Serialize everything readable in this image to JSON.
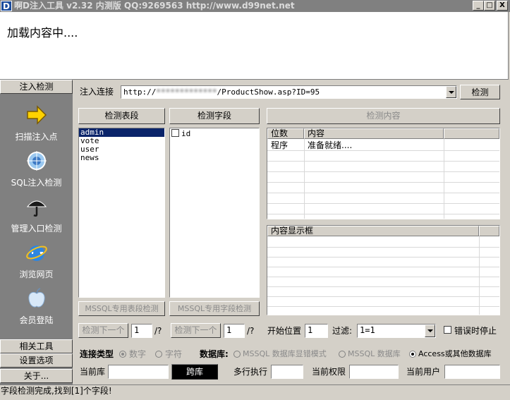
{
  "window": {
    "app_icon_letter": "D",
    "title": "啊D注入工具 v2.32 内测版 QQ:9269563 http://www.d99net.net",
    "btn_minimize": "_",
    "btn_maximize": "□",
    "btn_close": "X"
  },
  "browser": {
    "loading_text": "加载内容中...."
  },
  "sidebar": {
    "header": "注入检测",
    "items": [
      {
        "label": "扫描注入点",
        "icon": "arrow-right-icon"
      },
      {
        "label": "SQL注入检测",
        "icon": "globe-icon"
      },
      {
        "label": "管理入口检测",
        "icon": "umbrella-icon"
      },
      {
        "label": "浏览网页",
        "icon": "ie-icon"
      },
      {
        "label": "会员登陆",
        "icon": "apple-icon"
      }
    ],
    "footer": [
      "相关工具",
      "设置选项",
      "关于..."
    ]
  },
  "injection": {
    "label": "注入连接",
    "url_prefix": "http://",
    "url_masked": "*************",
    "url_suffix": "/ProductShow.asp?ID=95",
    "detect_button": "检测"
  },
  "tables": {
    "button": "检测表段",
    "items": [
      "admin",
      "vote",
      "user",
      "news"
    ],
    "selected_index": 0,
    "mssql_button": "MSSQL专用表段检测",
    "next_button": "检测下一个",
    "count_value": "1",
    "count_suffix": "/?"
  },
  "fields": {
    "button": "检测字段",
    "items": [
      "id"
    ],
    "mssql_button": "MSSQL专用字段检测",
    "next_button": "检测下一个",
    "count_value": "1",
    "count_suffix": "/?"
  },
  "content": {
    "button": "检测内容",
    "columns": [
      "位数",
      "内容"
    ],
    "rows": [
      {
        "pos": "程序",
        "content": "准备就绪...."
      }
    ],
    "display_header": "内容显示框"
  },
  "options": {
    "start_label": "开始位置",
    "start_value": "1",
    "filter_label": "过滤:",
    "filter_value": "1=1",
    "stop_on_error_label": "错误时停止",
    "stop_on_error": false
  },
  "connection": {
    "type_label": "连接类型",
    "type_numeric": "数字",
    "type_char": "字符",
    "db_label": "数据库:",
    "db_mssql_error": "MSSQL 数据库显错模式",
    "db_mssql": "MSSQL 数据库",
    "db_access": "Access或其他数据库",
    "selected_db": "access"
  },
  "info": {
    "current_db_label": "当前库",
    "current_db_value": "",
    "cross_db_button": "跨库",
    "multi_exec_label": "多行执行",
    "multi_exec_value": "",
    "current_priv_label": "当前权限",
    "current_priv_value": "",
    "current_user_label": "当前用户",
    "current_user_value": ""
  },
  "status": {
    "text": "字段检测完成,找到[1]个字段!"
  }
}
